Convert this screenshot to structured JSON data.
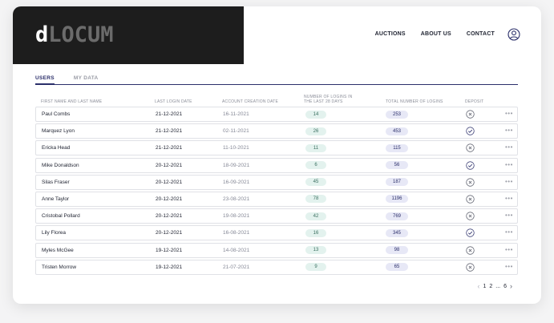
{
  "brand": {
    "logo_prefix": "d",
    "logo_rest": "LOCUM"
  },
  "nav": {
    "items": [
      "AUCTIONS",
      "ABOUT US",
      "CONTACT"
    ]
  },
  "tabs": [
    "USERS",
    "MY DATA"
  ],
  "table": {
    "headers": {
      "name": "FIRST NAME AND LAST NAME",
      "last_login": "LAST LOGIN DATE",
      "created": "ACCOUNT CREATION DATE",
      "logins_line1": "NUMBER OF LOGINS IN",
      "logins_line2": "THE LAST 28 DAYS",
      "total": "TOTAL NUMBER OF LOGINS",
      "deposit": "DEPOSIT"
    },
    "rows": [
      {
        "name": "Paul Combs",
        "last_login": "21-12-2021",
        "created": "16-11-2021",
        "logins": "14",
        "total": "253",
        "deposit": "no"
      },
      {
        "name": "Marquez Lyon",
        "last_login": "21-12-2021",
        "created": "02-11-2021",
        "logins": "26",
        "total": "453",
        "deposit": "yes"
      },
      {
        "name": "Ericka Head",
        "last_login": "21-12-2021",
        "created": "11-10-2021",
        "logins": "11",
        "total": "115",
        "deposit": "no"
      },
      {
        "name": "Mike Donaldson",
        "last_login": "20-12-2021",
        "created": "18-09-2021",
        "logins": "6",
        "total": "56",
        "deposit": "yes"
      },
      {
        "name": "Silas Fraser",
        "last_login": "20-12-2021",
        "created": "16-09-2021",
        "logins": "45",
        "total": "187",
        "deposit": "no"
      },
      {
        "name": "Anne Taylor",
        "last_login": "20-12-2021",
        "created": "23-08-2021",
        "logins": "78",
        "total": "1196",
        "deposit": "no"
      },
      {
        "name": "Cristobal Pollard",
        "last_login": "20-12-2021",
        "created": "19-08-2021",
        "logins": "42",
        "total": "769",
        "deposit": "no"
      },
      {
        "name": "Lily Florea",
        "last_login": "20-12-2021",
        "created": "16-08-2021",
        "logins": "16",
        "total": "345",
        "deposit": "yes"
      },
      {
        "name": "Myles McGee",
        "last_login": "19-12-2021",
        "created": "14-08-2021",
        "logins": "13",
        "total": "98",
        "deposit": "no"
      },
      {
        "name": "Tristen Morrow",
        "last_login": "19-12-2021",
        "created": "21-07-2021",
        "logins": "9",
        "total": "65",
        "deposit": "no"
      }
    ],
    "more_label": "•••"
  },
  "pagination": {
    "pages": [
      "1",
      "2",
      "...",
      "6"
    ]
  },
  "icons": {
    "user": "user-circle-icon",
    "deposit_yes": "check-circle-icon",
    "deposit_no": "x-circle-icon",
    "prev": "chevron-left-icon",
    "next": "chevron-right-icon",
    "more": "more-horizontal-icon"
  },
  "colors": {
    "accent": "#2b2f6a",
    "logins_pill_bg": "#e3f2ee",
    "total_pill_bg": "#e7e8f6",
    "header_dark": "#1d1d1d"
  }
}
